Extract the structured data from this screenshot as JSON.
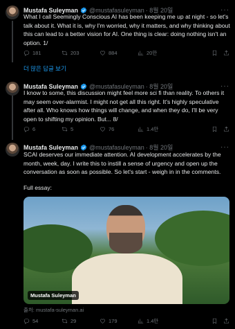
{
  "tweets": [
    {
      "name": "Mustafa Suleyman",
      "handle": "@mustafasuleyman",
      "date": "· 8월 20일",
      "text": "What I call Seemingly Conscious AI has been keeping me up at night - so let's talk about it. What it is, why I'm worried, why it matters, and why thinking about this can lead to a better vision for AI. One thing is clear: doing nothing isn't an option. 1/",
      "replies": "181",
      "reposts": "203",
      "likes": "884",
      "views": "20만"
    },
    {
      "name": "Mustafa Suleyman",
      "handle": "@mustafasuleyman",
      "date": "· 8월 20일",
      "text": "I know to some, this discussion might feel more sci fi than reality. To others it may seem over-alarmist. I might not get all this right. It's highly speculative after all. Who knows how things will change, and when they do, I'll be very open to shifting my opinion. But... 8/",
      "replies": "6",
      "reposts": "5",
      "likes": "76",
      "views": "1.4만"
    },
    {
      "name": "Mustafa Suleyman",
      "handle": "@mustafasuleyman",
      "date": "· 8월 20일",
      "text": "SCAI deserves our immediate attention. AI development accelerates by the month, week, day. I write this to instill a sense of urgency and open up the conversation as soon as possible. So let's start - weigh in in the comments.",
      "text2": "Full essay:",
      "media_label": "Mustafa Suleyman",
      "source": "출처: mustafa-suleyman.ai",
      "replies": "54",
      "reposts": "29",
      "likes": "179",
      "views": "1.4만"
    }
  ],
  "show_more": "더 많은 답글 보기",
  "colors": {
    "background": "#000000",
    "text": "#e7e9ea",
    "muted": "#71767b",
    "accent": "#1d9bf0"
  }
}
